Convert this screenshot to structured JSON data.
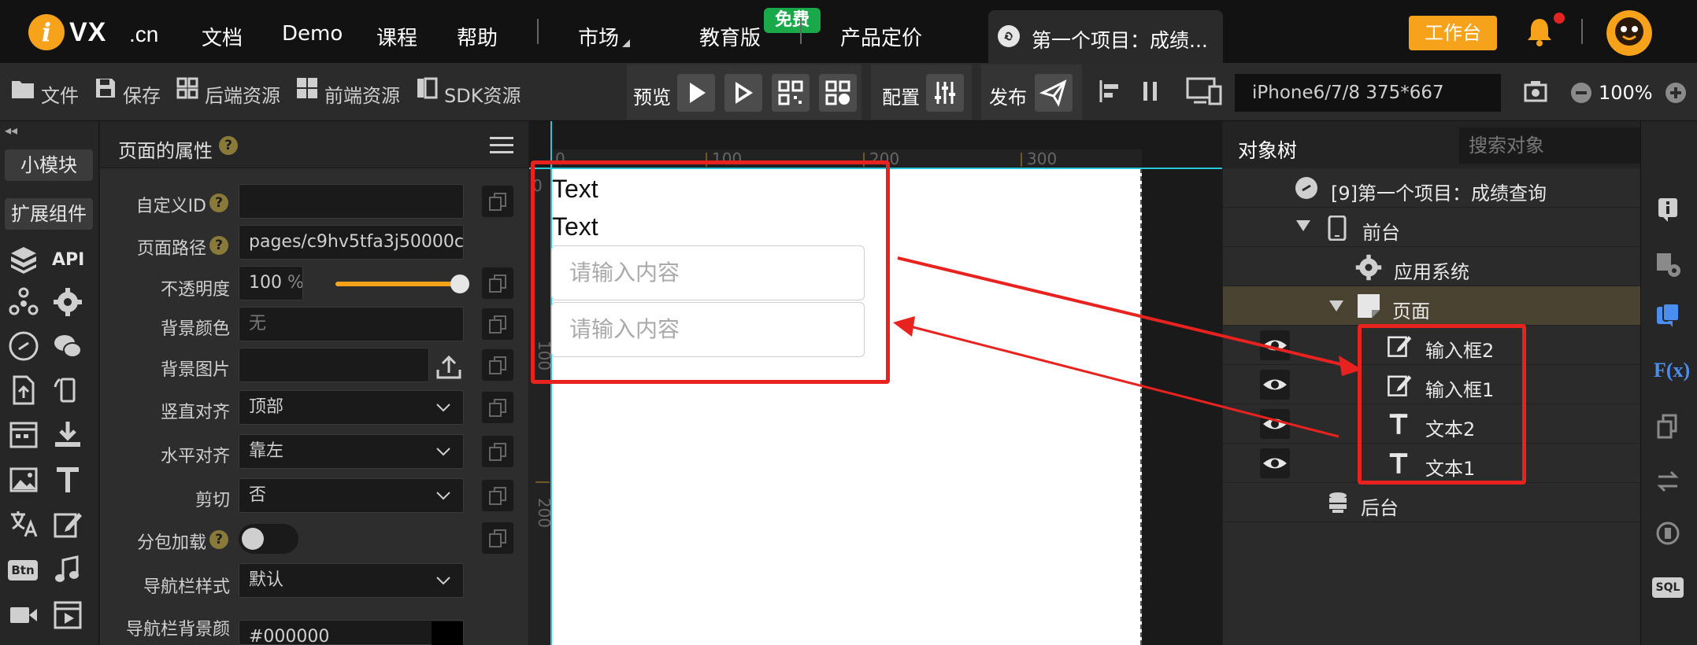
{
  "topnav": {
    "logo_mark": "i",
    "logo_text": "VX",
    "logo_suffix": ".cn",
    "items": [
      "文档",
      "Demo",
      "课程",
      "帮助",
      "市场",
      "教育版",
      "产品定价"
    ],
    "badge_free": "免费",
    "project_tab": "第一个项目：成绩...",
    "workbench": "工作台"
  },
  "toolbar": {
    "file": "文件",
    "save": "保存",
    "backend": "后端资源",
    "frontend": "前端资源",
    "sdk": "SDK资源",
    "preview": "预览",
    "config": "配置",
    "publish": "发布",
    "device": "iPhone6/7/8 375*667",
    "zoom": "100%"
  },
  "leftrail": {
    "collapse": "◂◂",
    "small_module": "小模块",
    "ext_components": "扩展组件",
    "api": "API",
    "btn_icon_label": "Btn"
  },
  "props": {
    "title": "页面的属性",
    "help_mark": "?",
    "rows": [
      {
        "label": "自定义ID",
        "value": "",
        "has_help": true
      },
      {
        "label": "页面路径",
        "value": "pages/c9hv5tfa3j50000c",
        "has_help": true
      },
      {
        "label": "不透明度",
        "value": "100",
        "unit": "%"
      },
      {
        "label": "背景颜色",
        "value": "",
        "placeholder": "无"
      },
      {
        "label": "背景图片",
        "value": ""
      },
      {
        "label": "竖直对齐",
        "value": "顶部"
      },
      {
        "label": "水平对齐",
        "value": "靠左"
      },
      {
        "label": "剪切",
        "value": "否"
      },
      {
        "label": "分包加载",
        "value": "",
        "has_help": true
      },
      {
        "label": "导航栏样式",
        "value": "默认"
      },
      {
        "label": "导航栏背景颜",
        "value": "#000000"
      }
    ],
    "opacity_level": 1.0
  },
  "canvas": {
    "ruler_top": [
      "0",
      "100",
      "200",
      "300"
    ],
    "ruler_left": [
      "0",
      "100",
      "200"
    ],
    "text1": "Text",
    "text2": "Text",
    "input_placeholder_1": "请输入内容",
    "input_placeholder_2": "请输入内容"
  },
  "tree": {
    "tab": "对象树",
    "search_placeholder": "搜索对象",
    "project": "[9]第一个项目：成绩查询",
    "frontend": "前台",
    "app_system": "应用系统",
    "page": "页面",
    "input2": "输入框2",
    "input1": "输入框1",
    "text2": "文本2",
    "text1": "文本1",
    "backend": "后台"
  },
  "rightrail": {
    "fx": "F(x)",
    "sql": "SQL"
  },
  "colors": {
    "accent": "#f7a21b",
    "annotation": "#e8221f",
    "guide": "#25c7d8",
    "free_badge": "#19a94a"
  }
}
